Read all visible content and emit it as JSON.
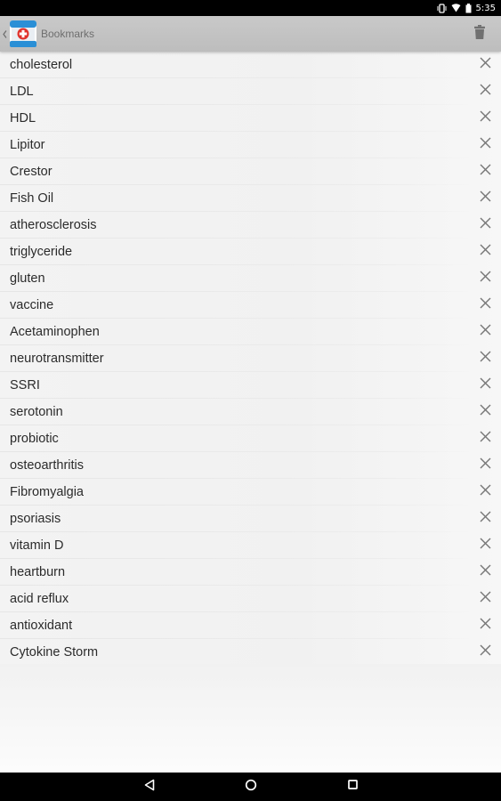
{
  "status_bar": {
    "time": "5:35",
    "icons": [
      "vibrate-icon",
      "wifi-icon",
      "battery-icon"
    ]
  },
  "action_bar": {
    "title": "Bookmarks",
    "app_icon": "medical-app-icon",
    "action_icon": "trash-icon"
  },
  "bookmarks": [
    "cholesterol",
    "LDL",
    "HDL",
    "Lipitor",
    "Crestor",
    "Fish Oil",
    "atherosclerosis",
    "triglyceride",
    "gluten",
    "vaccine",
    "Acetaminophen",
    "neurotransmitter",
    "SSRI",
    "serotonin",
    "probiotic",
    "osteoarthritis",
    "Fibromyalgia",
    "psoriasis",
    "vitamin D",
    "heartburn",
    "acid reflux",
    "antioxidant",
    "Cytokine Storm"
  ],
  "row_action_icon": "close-icon",
  "nav_bar": {
    "icons": [
      "back-icon",
      "home-icon",
      "recents-icon"
    ]
  },
  "colors": {
    "action_bar": "#c4c4c4",
    "app_icon_blue": "#2a8fd6",
    "app_icon_red": "#e0312b",
    "text": "#2b2b2b",
    "close_icon": "#777777"
  }
}
